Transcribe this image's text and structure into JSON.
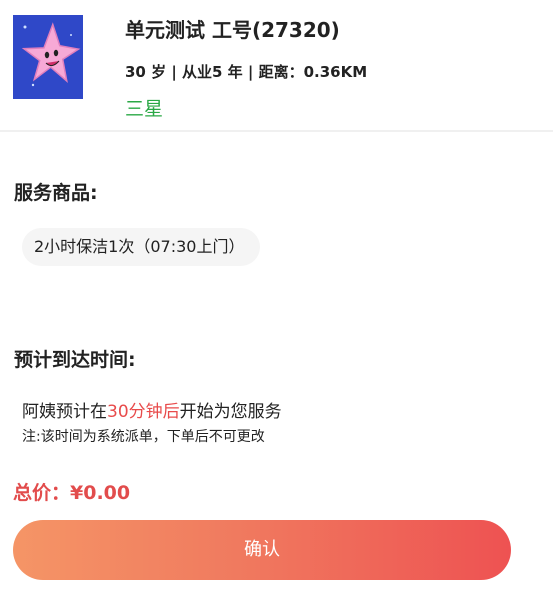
{
  "header": {
    "name": "单元测试 工号(27320)",
    "info": "30 岁 | 从业5 年 | 距离：0.36KM",
    "level": "三星"
  },
  "goods": {
    "title": "服务商品:",
    "item": "2小时保洁1次（07:30上门）"
  },
  "arrival": {
    "title": "预计到达时间:",
    "text_prefix": "阿姨预计在",
    "text_highlight": "30分钟后",
    "text_suffix": "开始为您服务",
    "note": "注:该时间为系统派单，下单后不可更改"
  },
  "total": {
    "text": "总价：¥0.00"
  },
  "confirm": {
    "label": "确认"
  },
  "colors": {
    "level": "#2aa845",
    "highlight": "#e84b4b",
    "button_start": "#f59566",
    "button_end": "#ee5252"
  }
}
